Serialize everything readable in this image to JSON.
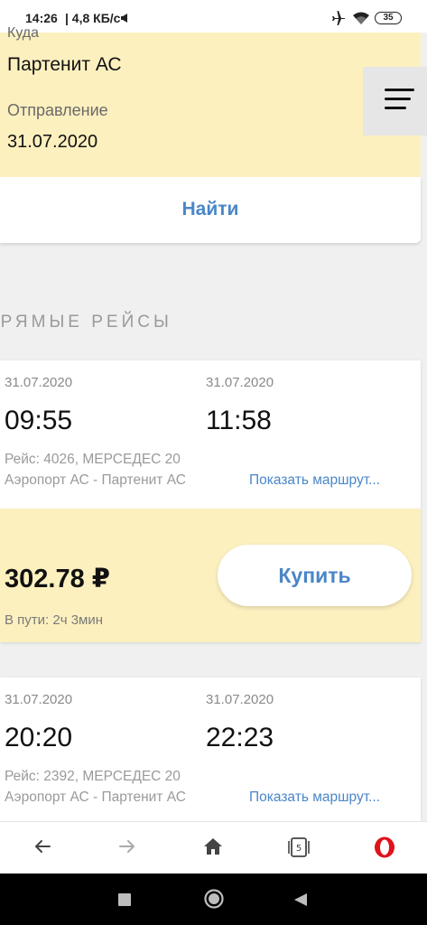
{
  "status_bar": {
    "time": "14:26",
    "network_speed": "| 4,8 КБ/с",
    "battery": "35"
  },
  "form": {
    "to_label": "Куда",
    "to_value": "Партенит АС",
    "departure_label": "Отправление",
    "departure_value": "31.07.2020"
  },
  "find_button": "Найти",
  "section_title": "ПРЯМЫЕ РЕЙСЫ",
  "trips": [
    {
      "dep_date": "31.07.2020",
      "arr_date": "31.07.2020",
      "dep_time": "09:55",
      "arr_time": "11:58",
      "info": "Рейс: 4026, МЕРСЕДЕС 20",
      "route": "Аэропорт АС - Партенит АС",
      "show_route": "Показать маршрут...",
      "price": "302.78 ₽",
      "duration": "В пути: 2ч 3мин",
      "buy_label": "Купить"
    },
    {
      "dep_date": "31.07.2020",
      "arr_date": "31.07.2020",
      "dep_time": "20:20",
      "arr_time": "22:23",
      "info": "Рейс: 2392, МЕРСЕДЕС 20",
      "route": "Аэропорт АС - Партенит АС",
      "show_route": "Показать маршрут..."
    }
  ],
  "browser_bar": {
    "tab_count": "5",
    "icons": [
      "back-icon",
      "forward-icon",
      "home-icon",
      "tabs-icon",
      "opera-icon"
    ]
  },
  "colors": {
    "accent_blue": "#4a86c8",
    "highlight_yellow": "#fdf0bf",
    "opera_red": "#e0121b"
  }
}
